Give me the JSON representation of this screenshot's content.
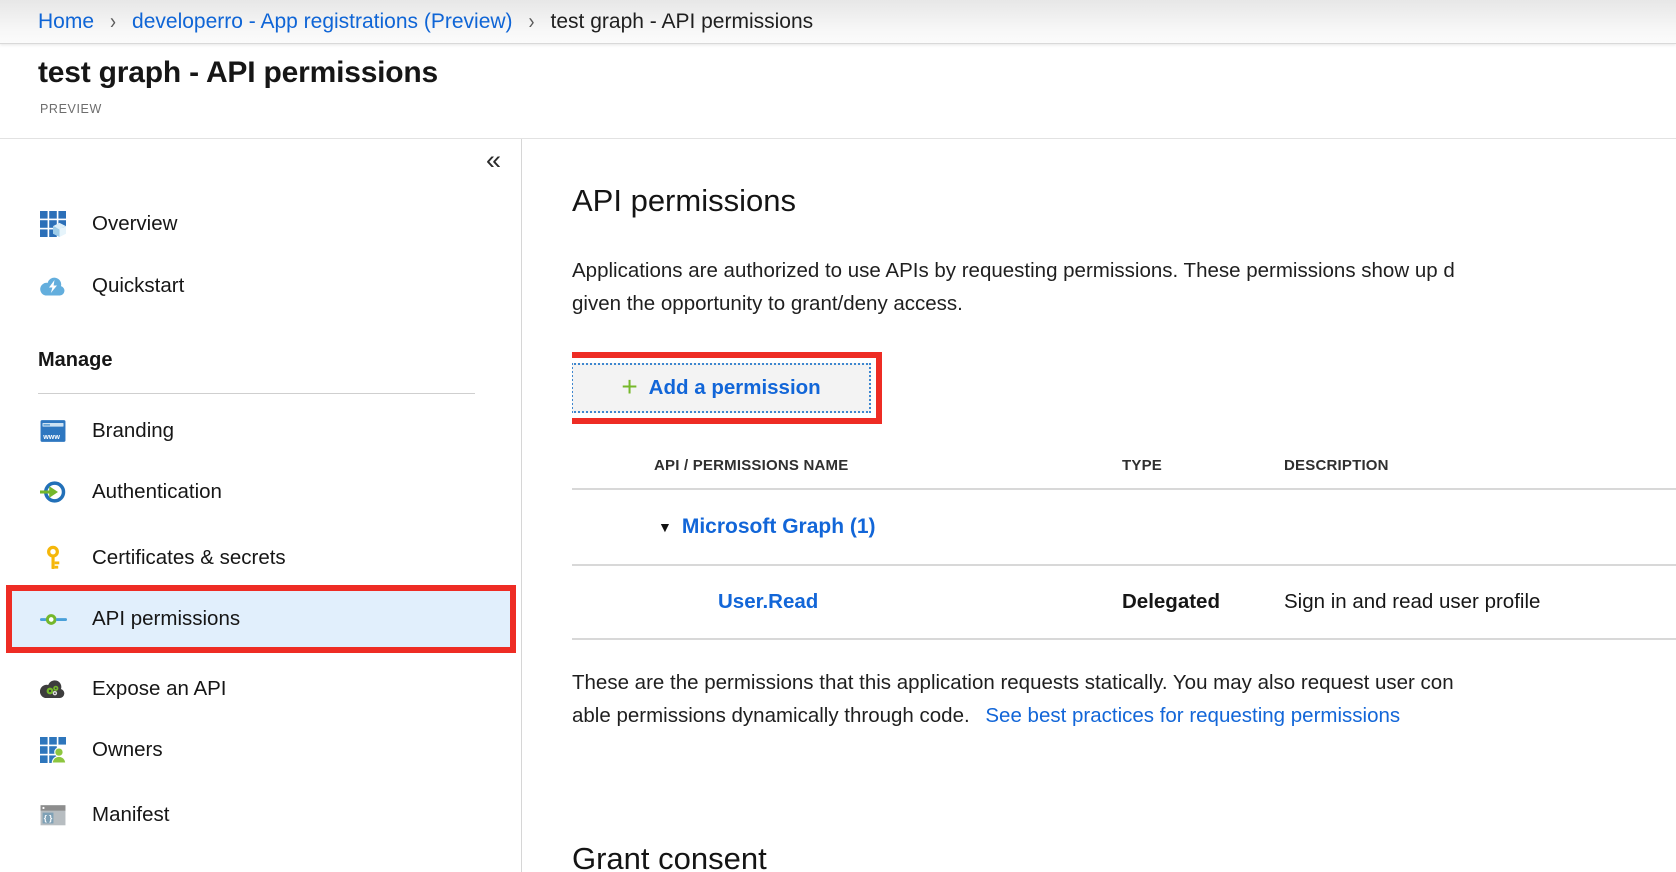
{
  "colors": {
    "link_blue": "#0f65d6",
    "annotation_red": "#ee2c24",
    "plus_green": "#76b82a",
    "selected_item_bg": "#e1effc"
  },
  "breadcrumb": {
    "separator": "›",
    "items": [
      {
        "label": "Home"
      },
      {
        "label": "developerro - App registrations (Preview)"
      },
      {
        "label": "test graph - API permissions"
      }
    ]
  },
  "header": {
    "title": "test graph - API permissions",
    "badge": "PREVIEW"
  },
  "sidebar": {
    "collapse_icon": "«",
    "top_items": [
      {
        "label": "Overview"
      },
      {
        "label": "Quickstart"
      }
    ],
    "section_label": "Manage",
    "manage_items": [
      {
        "label": "Branding"
      },
      {
        "label": "Authentication"
      },
      {
        "label": "Certificates & secrets"
      },
      {
        "label": "API permissions",
        "selected": true
      },
      {
        "label": "Expose an API"
      },
      {
        "label": "Owners"
      },
      {
        "label": "Manifest"
      }
    ]
  },
  "main": {
    "title": "API permissions",
    "intro_line1": "Applications are authorized to use APIs by requesting permissions. These permissions show up d",
    "intro_line2": "given the opportunity to grant/deny access.",
    "add_permission": {
      "plus": "+",
      "label": "Add a permission"
    },
    "table": {
      "columns": [
        "API / PERMISSIONS NAME",
        "TYPE",
        "DESCRIPTION"
      ],
      "group": {
        "caret": "▼",
        "name": "Microsoft Graph (1)"
      },
      "rows": [
        {
          "permission": "User.Read",
          "type": "Delegated",
          "description": "Sign in and read user profile"
        }
      ]
    },
    "footnote_line1": "These are the permissions that this application requests statically. You may also request user con",
    "footnote_line2": "able permissions dynamically through code. ",
    "footnote_link": "See best practices for requesting permissions",
    "grant_title": "Grant consent"
  }
}
